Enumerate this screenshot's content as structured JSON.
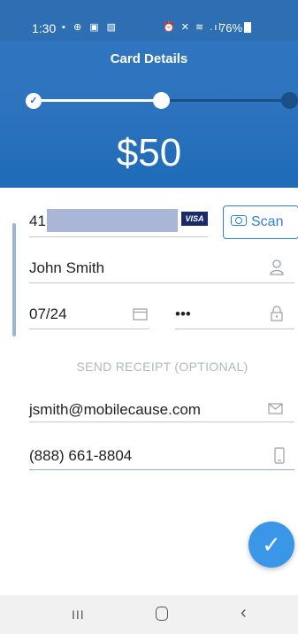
{
  "status_bar": {
    "time": "1:30",
    "left_icons": "▪ ⊕ ▣ ▨",
    "right_icons": "⏰ ✕ ≋ .ıl",
    "battery": "76%"
  },
  "header": {
    "title": "Card Details",
    "amount": "$50",
    "step_done_mark": "✓"
  },
  "form": {
    "card_number_visible": "41",
    "card_brand": "VISA",
    "scan_label": "Scan",
    "name": "John Smith",
    "expiry": "07/24",
    "cvv": "•••",
    "receipt_label": "SEND RECEIPT (OPTIONAL)",
    "email": "jsmith@mobilecause.com",
    "phone": "(888) 661-8804"
  },
  "fab": {
    "icon": "✓"
  },
  "navbar": {
    "recent": "III",
    "back": "‹"
  },
  "colors": {
    "header_blue": "#2e6fb4",
    "accent_blue": "#3a96e6",
    "card_mask": "#aab6d8"
  }
}
